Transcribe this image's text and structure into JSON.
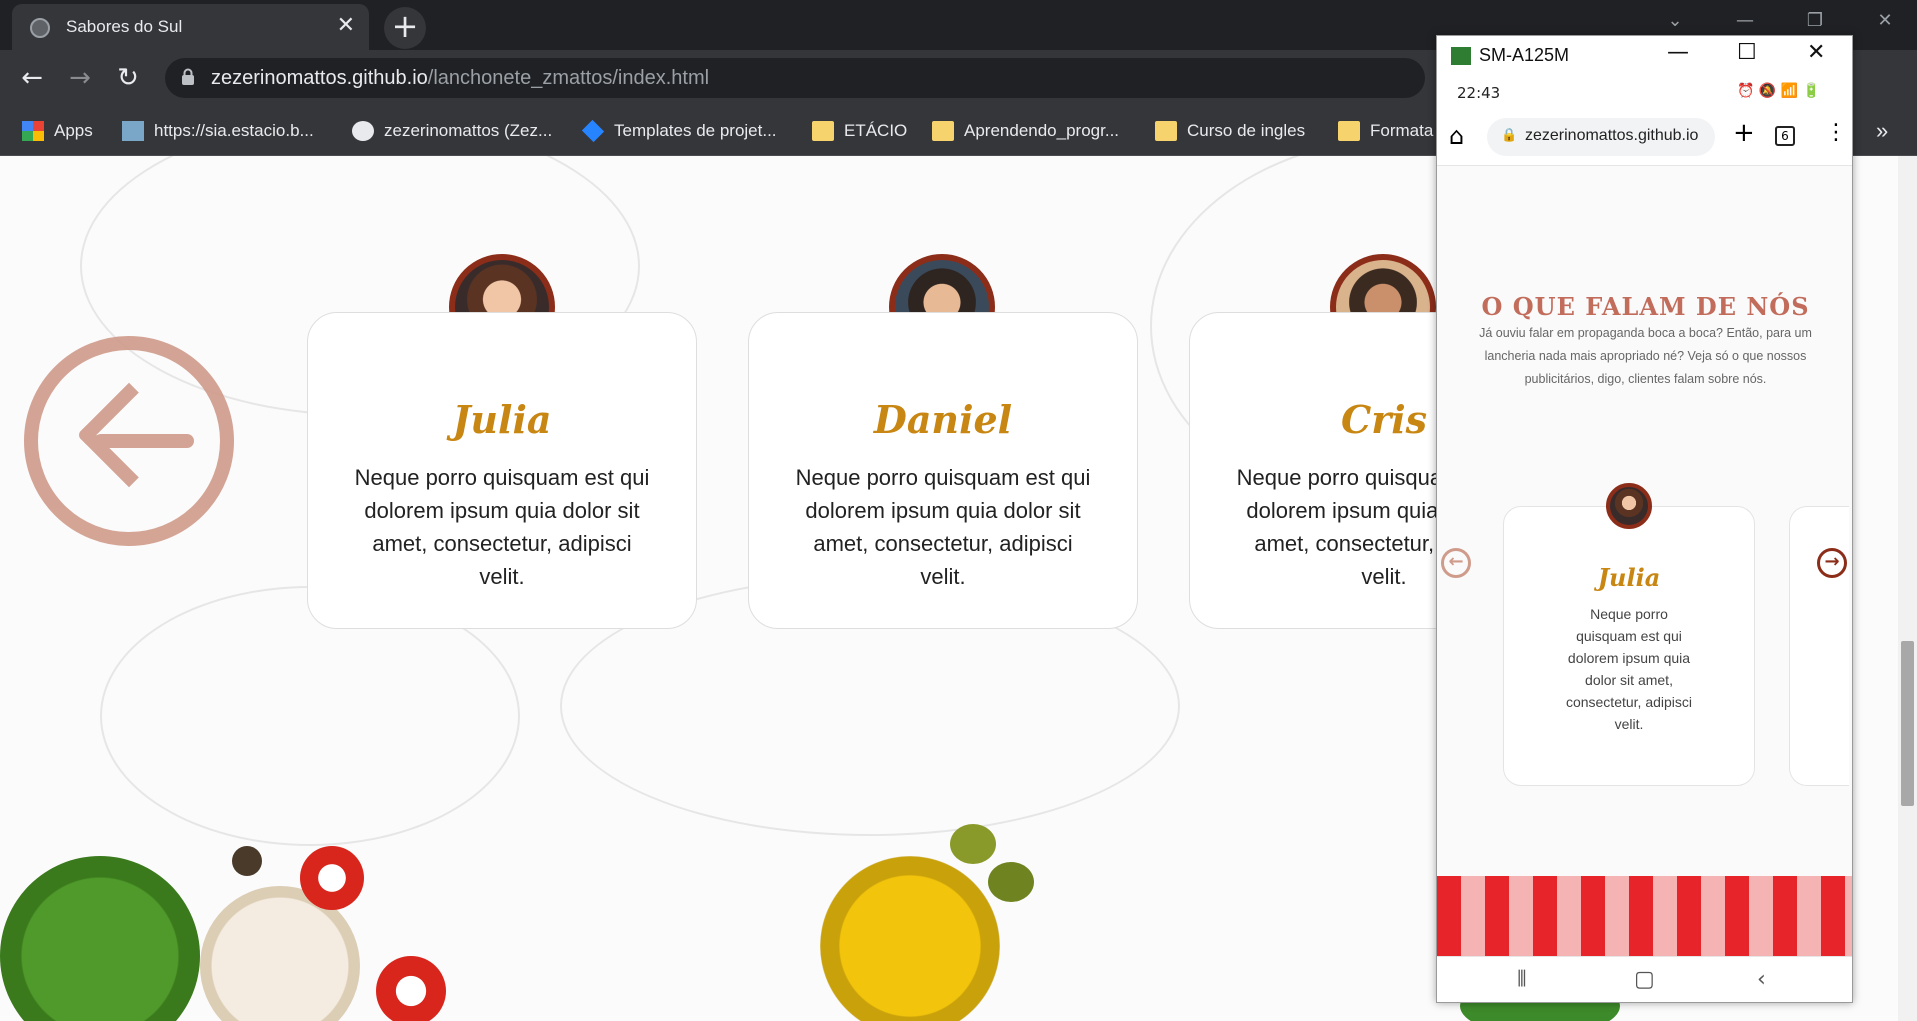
{
  "browser": {
    "tab_title": "Sabores do Sul",
    "url_host": "zezerinomattos.github.io",
    "url_path": "/lanchonete_zmattos/index.html",
    "bookmarks": [
      "Apps",
      "https://sia.estacio.b...",
      "zezerinomattos (Zez...",
      "Templates de projet...",
      "ETÁCIO",
      "Aprendendo_progr...",
      "Curso de ingles",
      "Formata"
    ]
  },
  "testimonials": [
    {
      "name": "Julia",
      "text": "Neque porro quisquam est qui dolorem ipsum quia dolor sit amet, consectetur, adipisci velit."
    },
    {
      "name": "Daniel",
      "text": "Neque porro quisquam est qui dolorem ipsum quia dolor sit amet, consectetur, adipisci velit."
    },
    {
      "name": "Cris",
      "text": "Neque porro quisquam est qui dolorem ipsum quia dolor sit amet, consectetur, adipisci velit."
    }
  ],
  "phone": {
    "window_title": "SM-A125M",
    "time": "22:43",
    "url": "zezerinomattos.github.io",
    "tab_count": "6",
    "heading": "O QUE FALAM DE NÓS",
    "intro": "Já ouviu falar em propaganda boca a boca? Então, para um lancheria nada mais apropriado né? Veja só o que nossos publicitários, digo, clientes falam sobre nós.",
    "card_name": "Julia",
    "card_text": "Neque porro quisquam est qui dolorem ipsum quia dolor sit amet, consectetur, adipisci velit."
  },
  "colors": {
    "brand_gold": "#c88612",
    "avatar_ring": "#8c2d19",
    "arrow": "#cf9b8a"
  }
}
